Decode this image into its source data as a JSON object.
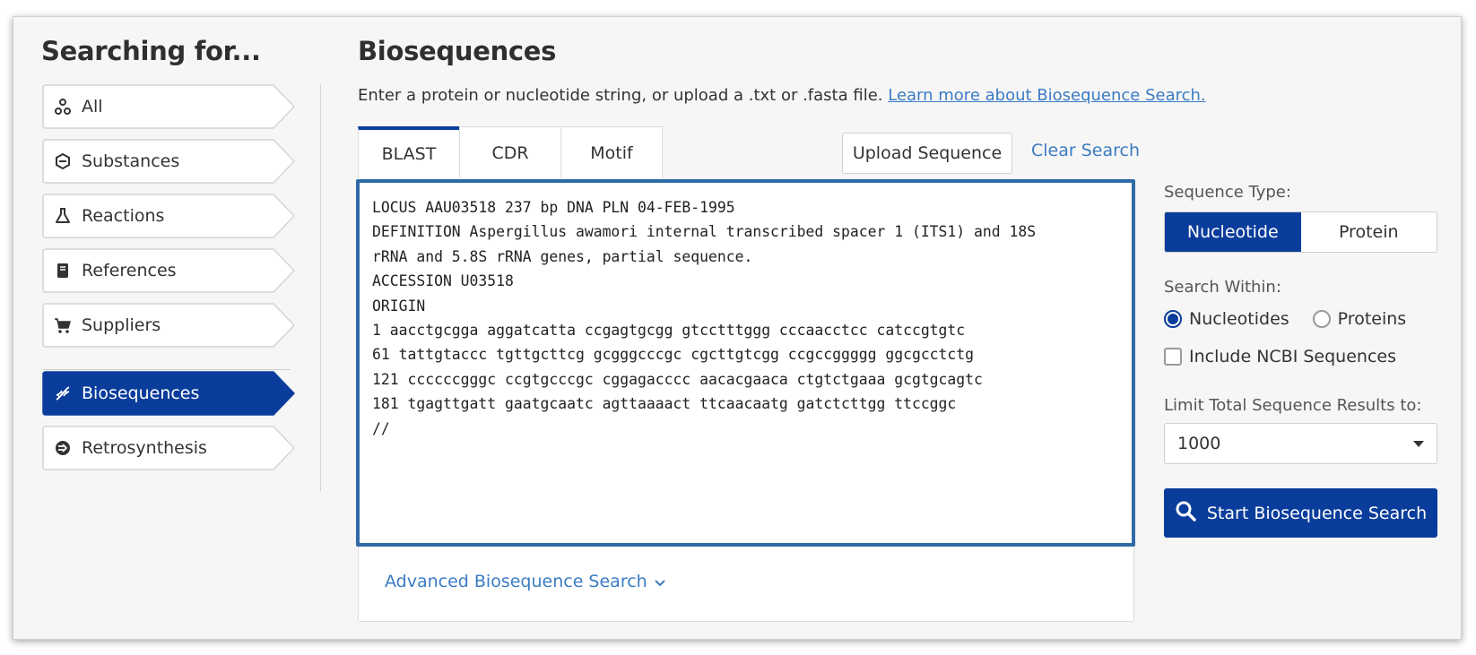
{
  "sidebar": {
    "title": "Searching for...",
    "items": [
      {
        "label": "All",
        "icon": "network-icon",
        "active": false
      },
      {
        "label": "Substances",
        "icon": "hexagon-icon",
        "active": false
      },
      {
        "label": "Reactions",
        "icon": "flask-icon",
        "active": false
      },
      {
        "label": "References",
        "icon": "book-icon",
        "active": false
      },
      {
        "label": "Suppliers",
        "icon": "cart-icon",
        "active": false
      },
      {
        "label": "Biosequences",
        "icon": "dna-icon",
        "active": true
      },
      {
        "label": "Retrosynthesis",
        "icon": "retrosynthesis-icon",
        "active": false
      }
    ]
  },
  "main": {
    "title": "Biosequences",
    "description": "Enter a protein or nucleotide string, or upload a .txt or .fasta file.",
    "learn_more": "Learn more about Biosequence Search.",
    "tabs": [
      {
        "label": "BLAST",
        "active": true
      },
      {
        "label": "CDR",
        "active": false
      },
      {
        "label": "Motif",
        "active": false
      }
    ],
    "upload_label": "Upload Sequence",
    "clear_label": "Clear Search",
    "sequence_text": "LOCUS AAU03518 237 bp DNA PLN 04-FEB-1995\nDEFINITION Aspergillus awamori internal transcribed spacer 1 (ITS1) and 18S\nrRNA and 5.8S rRNA genes, partial sequence.\nACCESSION U03518\nORIGIN\n1 aacctgcgga aggatcatta ccgagtgcgg gtcctttggg cccaacctcc catccgtgtc\n61 tattgtaccc tgttgcttcg gcgggcccgc cgcttgtcgg ccgccggggg ggcgcctctg\n121 ccccccgggc ccgtgcccgc cggagacccc aacacgaaca ctgtctgaaa gcgtgcagtc\n181 tgagttgatt gaatgcaatc agttaaaact ttcaacaatg gatctcttgg ttccggc\n//",
    "advanced_label": "Advanced Biosequence Search"
  },
  "options": {
    "sequence_type_label": "Sequence Type:",
    "sequence_types": [
      {
        "label": "Nucleotide",
        "active": true
      },
      {
        "label": "Protein",
        "active": false
      }
    ],
    "search_within_label": "Search Within:",
    "search_within": [
      {
        "label": "Nucleotides",
        "checked": true
      },
      {
        "label": "Proteins",
        "checked": false
      }
    ],
    "include_ncbi_label": "Include NCBI Sequences",
    "include_ncbi_checked": false,
    "limit_label": "Limit Total Sequence Results to:",
    "limit_value": "1000",
    "start_label": "Start Biosequence Search"
  },
  "colors": {
    "accent": "#0a3d9b",
    "link": "#3b7cc4",
    "textarea_border": "#2f6aa7"
  }
}
